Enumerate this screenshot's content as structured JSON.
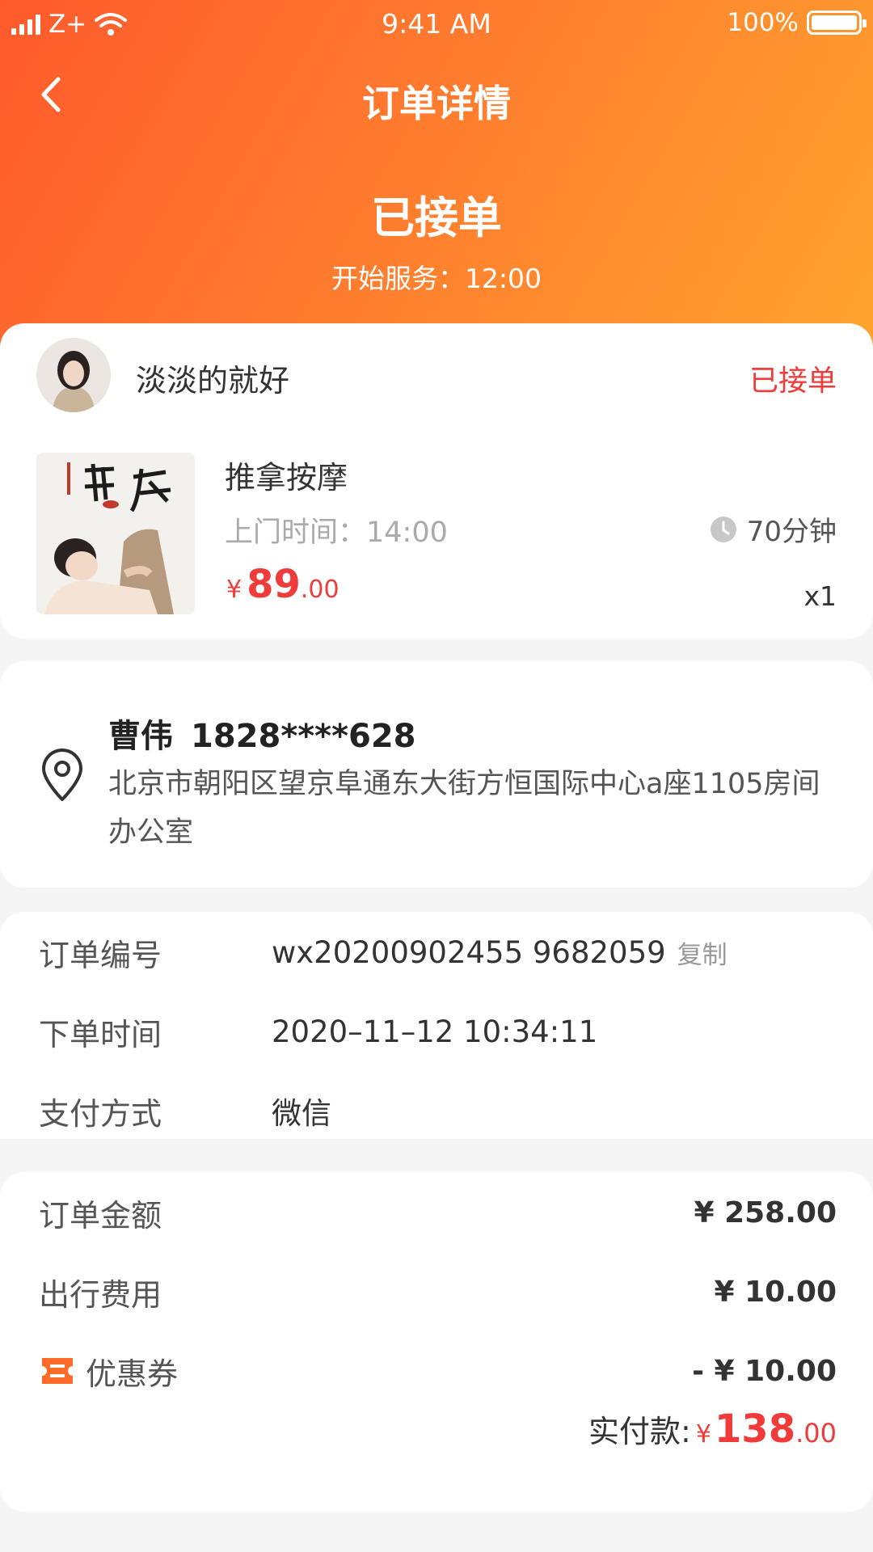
{
  "status_bar": {
    "carrier": "Z+",
    "time": "9:41 AM",
    "battery": "100%"
  },
  "nav": {
    "title": "订单详情"
  },
  "order_state": {
    "title": "已接单",
    "subtitle": "开始服务：12:00"
  },
  "provider": {
    "nickname": "淡淡的就好",
    "status": "已接单"
  },
  "service": {
    "name": "推拿按摩",
    "visit_time": "上门时间：14:00",
    "duration": "70分钟",
    "price_currency": "¥",
    "price_integer": "89",
    "price_decimal": ".00",
    "quantity": "x1"
  },
  "address": {
    "name": "曹伟",
    "phone": "1828****628",
    "detail": "北京市朝阳区望京阜通东大街方恒国际中心a座1105房间办公室"
  },
  "order_info": {
    "rows": [
      {
        "label": "订单编号",
        "value": "wx20200902455 9682059"
      },
      {
        "label": "下单时间",
        "value": "2020–11–12 10:34:11"
      },
      {
        "label": "支付方式",
        "value": "微信"
      }
    ],
    "copy_label": "复制"
  },
  "amounts": {
    "rows": [
      {
        "label": "订单金额",
        "value": "¥ 258.00"
      },
      {
        "label": "出行费用",
        "value": "¥ 10.00"
      },
      {
        "label": "优惠券",
        "value": "- ¥ 10.00"
      }
    ],
    "total_label": "实付款:",
    "total_currency": "¥",
    "total_integer": "138",
    "total_decimal": ".00"
  },
  "colors": {
    "header_start": "#ff5a2c",
    "header_end": "#ffa52e",
    "accent_red": "#f03b3b",
    "coupon_orange": "#ff6a2b"
  }
}
